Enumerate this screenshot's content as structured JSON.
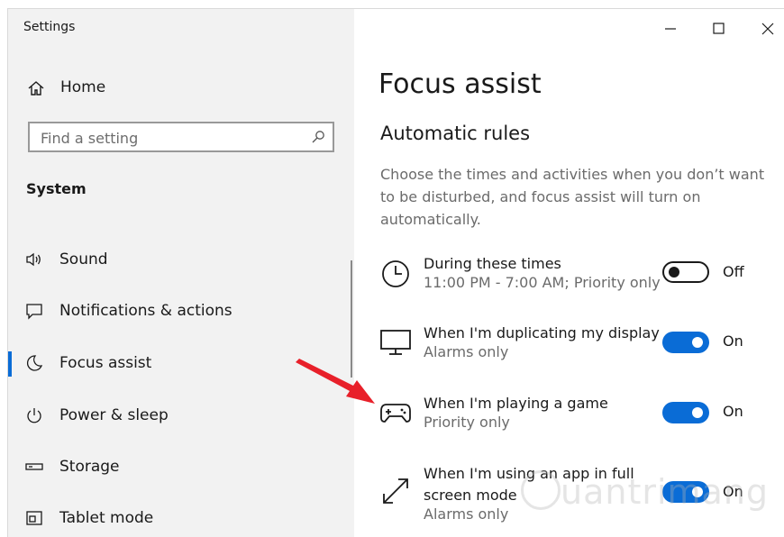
{
  "window": {
    "title": "Settings",
    "controls": {
      "minimize_icon": "minimize-icon",
      "maximize_icon": "maximize-icon",
      "close_icon": "close-icon"
    }
  },
  "sidebar": {
    "home_label": "Home",
    "search": {
      "placeholder": "Find a setting"
    },
    "section_title": "System",
    "items": [
      {
        "label": "Sound",
        "icon": "speaker-icon",
        "selected": false
      },
      {
        "label": "Notifications & actions",
        "icon": "message-icon",
        "selected": false
      },
      {
        "label": "Focus assist",
        "icon": "moon-icon",
        "selected": true
      },
      {
        "label": "Power & sleep",
        "icon": "power-icon",
        "selected": false
      },
      {
        "label": "Storage",
        "icon": "storage-icon",
        "selected": false
      },
      {
        "label": "Tablet mode",
        "icon": "tablet-icon",
        "selected": false
      }
    ]
  },
  "main": {
    "title": "Focus assist",
    "subtitle": "Automatic rules",
    "description": "Choose the times and activities when you don’t want to be disturbed, and focus assist will turn on automatically.",
    "rules": [
      {
        "title": "During these times",
        "subtitle": "11:00 PM - 7:00 AM; Priority only",
        "state": "Off",
        "on": false,
        "icon": "clock-icon"
      },
      {
        "title": "When I'm duplicating my display",
        "subtitle": "Alarms only",
        "state": "On",
        "on": true,
        "icon": "monitor-icon"
      },
      {
        "title": "When I'm playing a game",
        "subtitle": "Priority only",
        "state": "On",
        "on": true,
        "icon": "gamepad-icon"
      },
      {
        "title": "When I'm using an app in full screen mode",
        "subtitle": "Alarms only",
        "state": "On",
        "on": true,
        "icon": "fullscreen-icon"
      }
    ]
  },
  "watermark": {
    "text": "uantrimang"
  },
  "colors": {
    "accent": "#0a6cd6",
    "arrow": "#e8202a",
    "sidebar_bg": "#f2f2f2"
  }
}
